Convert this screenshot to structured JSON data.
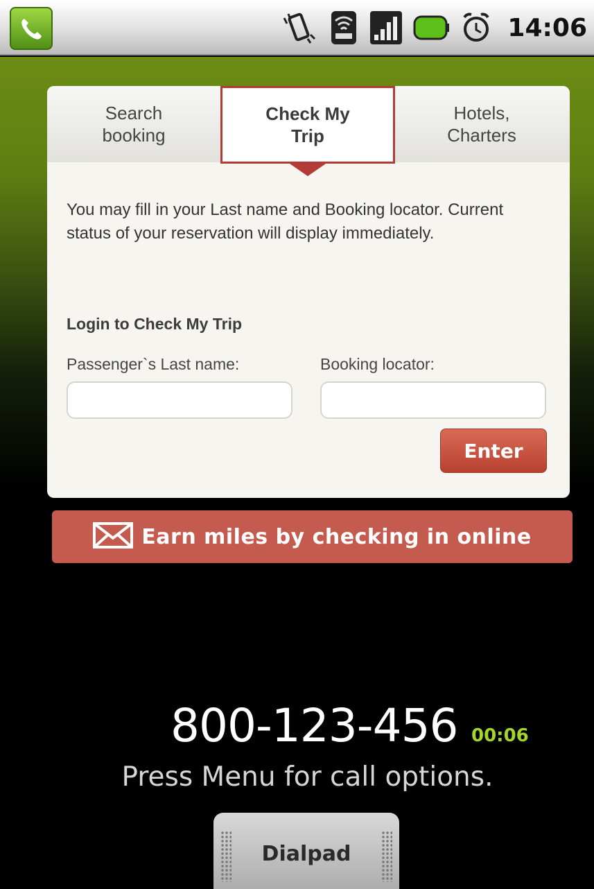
{
  "status_bar": {
    "time": "14:06",
    "icons": [
      "phone-app-icon",
      "vibrate-icon",
      "wifi-icon",
      "signal-icon",
      "battery-icon",
      "alarm-icon"
    ]
  },
  "tabs": [
    {
      "label": "Search\nbooking",
      "active": false
    },
    {
      "label": "Check My\nTrip",
      "active": true
    },
    {
      "label": "Hotels,\nCharters",
      "active": false
    }
  ],
  "intro_text": "You may fill in your Last name and Booking locator. Current status of your reservation will display immediately.",
  "login": {
    "title": "Login to Check My Trip",
    "last_name_label": "Passenger`s Last name:",
    "last_name_value": "",
    "locator_label": "Booking locator:",
    "locator_value": "",
    "enter_label": "Enter"
  },
  "banner": {
    "text": "Earn miles by checking in online",
    "icon": "envelope-icon"
  },
  "call": {
    "number": "800-123-456",
    "timer": "00:06",
    "hint": "Press Menu for call options.",
    "dialpad_label": "Dialpad"
  },
  "colors": {
    "accent_red": "#b43a35",
    "banner_red": "#c55a4e",
    "timer_green": "#a3d629",
    "status_green": "#6c8c14"
  }
}
